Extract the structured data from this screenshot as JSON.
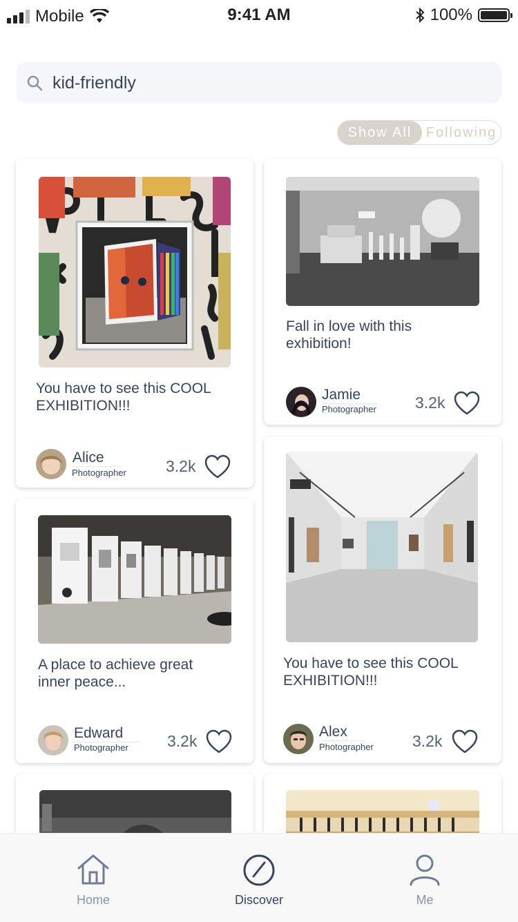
{
  "status": {
    "carrier": "Mobile",
    "time": "9:41 AM",
    "battery": "100%"
  },
  "search": {
    "query": "kid-friendly"
  },
  "filter": {
    "show_all": "Show All",
    "following": "Following"
  },
  "cards": [
    {
      "title": "You have to see this COOL EXHIBITION!!!",
      "author": "Alice",
      "role": "Photographer",
      "likes": "3.2k"
    },
    {
      "title": "Fall in love with this exhibition!",
      "author": "Jamie",
      "role": "Photographer",
      "likes": "3.2k"
    },
    {
      "title": "A place to achieve great inner peace...",
      "author": "Edward",
      "role": "Photographer",
      "likes": "3.2k"
    },
    {
      "title": "You have to see this COOL EXHIBITION!!!",
      "author": "Alex",
      "role": "Photographer",
      "likes": "3.2k"
    }
  ],
  "tabs": [
    {
      "label": "Home",
      "icon": "home-icon"
    },
    {
      "label": "Discover",
      "icon": "compass-icon"
    },
    {
      "label": "Me",
      "icon": "user-icon"
    }
  ],
  "colors": {
    "accent": "#37445a",
    "toggle_active_bg": "#d9d3ce",
    "muted": "#8a93a4"
  }
}
